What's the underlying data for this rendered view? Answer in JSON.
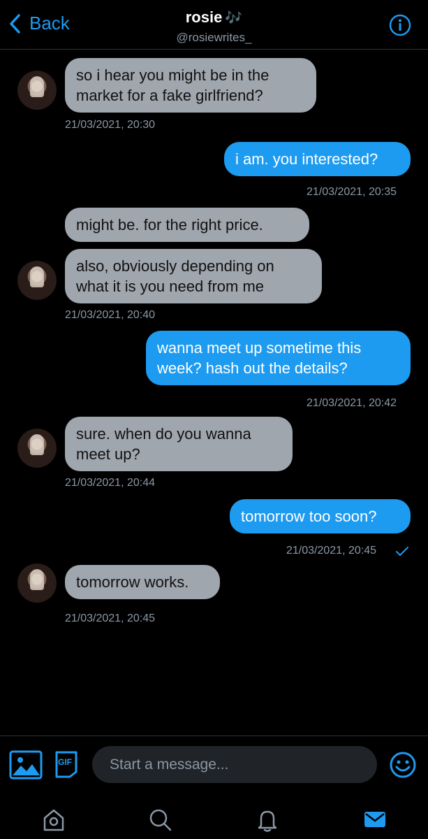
{
  "header": {
    "back_label": "Back",
    "title": "rosie",
    "title_emoji": "🎶",
    "handle": "@rosiewrites_"
  },
  "messages": [
    {
      "from": "them",
      "lines": [
        "so i hear you might be in the",
        "market for a fake girlfriend?"
      ],
      "time": "21/03/2021, 20:30"
    },
    {
      "from": "me",
      "lines": [
        "i am. you interested?"
      ],
      "time": "21/03/2021, 20:35"
    },
    {
      "from": "them",
      "lines": [
        "might be. for the right price."
      ],
      "time": ""
    },
    {
      "from": "them",
      "lines": [
        "also, obviously depending on",
        "what it is you need from me"
      ],
      "time": "21/03/2021, 20:40"
    },
    {
      "from": "me",
      "lines": [
        "wanna meet up sometime this",
        "week? hash out the details?"
      ],
      "time": "21/03/2021, 20:42"
    },
    {
      "from": "them",
      "lines": [
        "sure. when do you wanna",
        "meet up?"
      ],
      "time": "21/03/2021, 20:44"
    },
    {
      "from": "me",
      "lines": [
        "tomorrow too soon?"
      ],
      "time": "21/03/2021, 20:45",
      "read": true
    },
    {
      "from": "them",
      "lines": [
        "tomorrow works."
      ],
      "time": "21/03/2021, 20:45"
    }
  ],
  "composer": {
    "placeholder": "Start a message...",
    "gif_label": "GIF"
  },
  "colors": {
    "accent": "#1d9bf0",
    "incoming": "#a0a6ae",
    "background": "#000000"
  }
}
